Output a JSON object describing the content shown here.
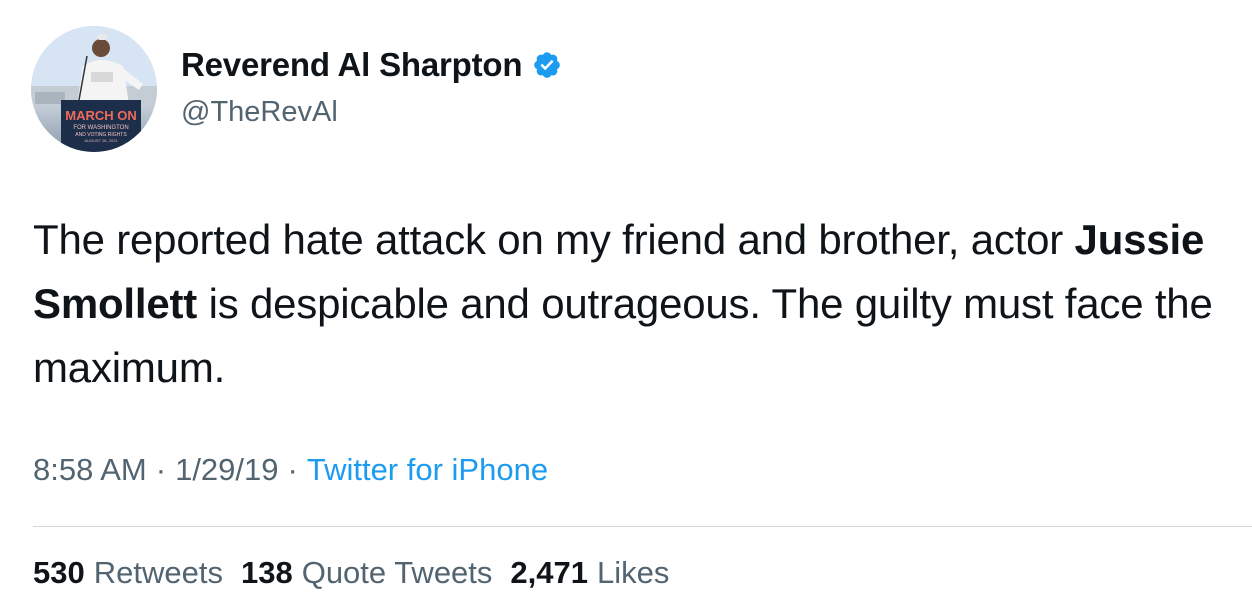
{
  "author": {
    "display_name": "Reverend Al Sharpton",
    "handle": "@TheRevAl",
    "verified": true,
    "verified_icon": "verified-badge-icon",
    "avatar": {
      "icon": "avatar-photo",
      "sign_text": "MARCH ON",
      "sign_subtext_1": "FOR WASHINGTON",
      "sign_subtext_2": "AND VOTING RIGHTS",
      "sign_subtext_3": "AUGUST 28, 2021"
    }
  },
  "tweet": {
    "text_before_bold": "The reported hate attack on my friend and brother, actor ",
    "bold_text": "Jussie Smollett",
    "text_after_bold": " is despicable and outrageous. The guilty must face the maximum."
  },
  "meta": {
    "time": "8:58 AM",
    "separator_1": "·",
    "date": "1/29/19",
    "separator_2": "·",
    "source": "Twitter for iPhone"
  },
  "stats": {
    "retweets_count": "530",
    "retweets_label": "Retweets",
    "quote_tweets_count": "138",
    "quote_tweets_label": "Quote Tweets",
    "likes_count": "2,471",
    "likes_label": "Likes"
  },
  "colors": {
    "text_primary": "#0f1419",
    "text_secondary": "#536471",
    "link_blue": "#1d9bf0",
    "divider": "#cfd9de"
  }
}
